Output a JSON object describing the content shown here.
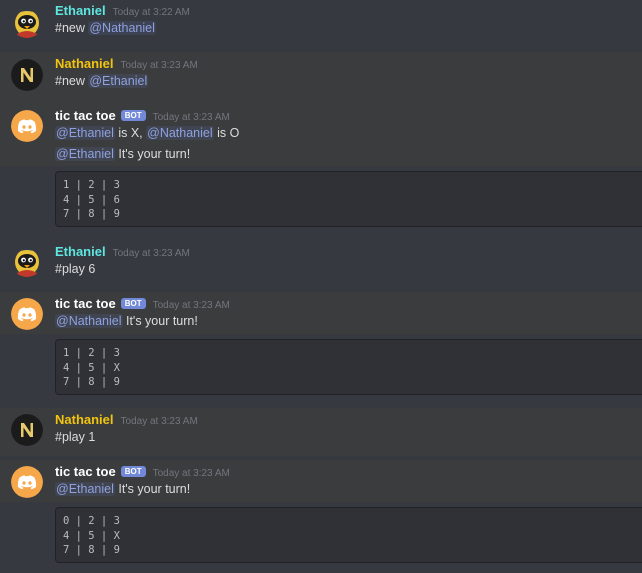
{
  "colors": {
    "background": "#36393f",
    "highlight": "#3b3c3e",
    "mention": "#8ea1e1",
    "ethaniel_name": "#5fe6e0",
    "nathaniel_name": "#f1c40f",
    "bot_tag": "#7289da",
    "bot_avatar": "#f5a74a"
  },
  "messages": [
    {
      "author": "Ethaniel",
      "avatar_icon": "bird-cartoon-avatar-icon",
      "timestamp": "Today at 3:22 AM",
      "lines": [
        {
          "prefix": "#new ",
          "mention": "@Nathaniel"
        }
      ]
    },
    {
      "author": "Nathaniel",
      "avatar_icon": "n-letter-logo-avatar-icon",
      "timestamp": "Today at 3:23 AM",
      "lines": [
        {
          "prefix": "#new ",
          "mention": "@Ethaniel"
        }
      ]
    },
    {
      "author": "tic tac toe",
      "bot_tag": "BOT",
      "avatar_icon": "discord-logo-avatar-icon",
      "timestamp": "Today at 3:23 AM",
      "line1": {
        "m1": "@Ethaniel",
        "t1": " is X, ",
        "m2": "@Nathaniel",
        "t2": " is O"
      },
      "line2": {
        "mention": "@Ethaniel",
        "text": " It's your turn!"
      },
      "board": [
        "1 | 2 | 3",
        "4 | 5 | 6",
        "7 | 8 | 9"
      ]
    },
    {
      "author": "Ethaniel",
      "avatar_icon": "bird-cartoon-avatar-icon",
      "timestamp": "Today at 3:23 AM",
      "text": "#play 6"
    },
    {
      "author": "tic tac toe",
      "bot_tag": "BOT",
      "avatar_icon": "discord-logo-avatar-icon",
      "timestamp": "Today at 3:23 AM",
      "line": {
        "mention": "@Nathaniel",
        "text": " It's your turn!"
      },
      "board": [
        "1 | 2 | 3",
        "4 | 5 | X",
        "7 | 8 | 9"
      ]
    },
    {
      "author": "Nathaniel",
      "avatar_icon": "n-letter-logo-avatar-icon",
      "timestamp": "Today at 3:23 AM",
      "text": "#play 1"
    },
    {
      "author": "tic tac toe",
      "bot_tag": "BOT",
      "avatar_icon": "discord-logo-avatar-icon",
      "timestamp": "Today at 3:23 AM",
      "line": {
        "mention": "@Ethaniel",
        "text": " It's your turn!"
      },
      "board": [
        "0 | 2 | 3",
        "4 | 5 | X",
        "7 | 8 | 9"
      ]
    }
  ]
}
